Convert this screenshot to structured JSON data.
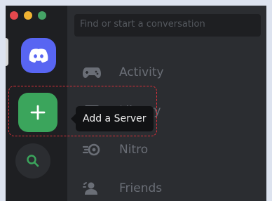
{
  "window": {
    "controls": [
      {
        "name": "close-dot",
        "color": "#e5484d"
      },
      {
        "name": "minimize-dot",
        "color": "#f0b232"
      },
      {
        "name": "maximize-dot",
        "color": "#45a366"
      }
    ]
  },
  "rail": {
    "home_icon": "discord-logo-icon",
    "home_color": "#5865f2",
    "add_server_icon": "plus-icon",
    "add_server_color": "#3ba55c",
    "search_icon": "search-icon",
    "search_icon_color": "#3ba55c"
  },
  "tooltip": {
    "text": "Add a Server"
  },
  "panel": {
    "search_placeholder": "Find or start a conversation",
    "nav": [
      {
        "label": "Activity",
        "icon": "gamepad-icon"
      },
      {
        "label": "Library",
        "icon": "library-icon"
      },
      {
        "label": "Nitro",
        "icon": "nitro-icon"
      },
      {
        "label": "Friends",
        "icon": "friends-icon"
      }
    ]
  },
  "highlight_color": "#e0303a"
}
